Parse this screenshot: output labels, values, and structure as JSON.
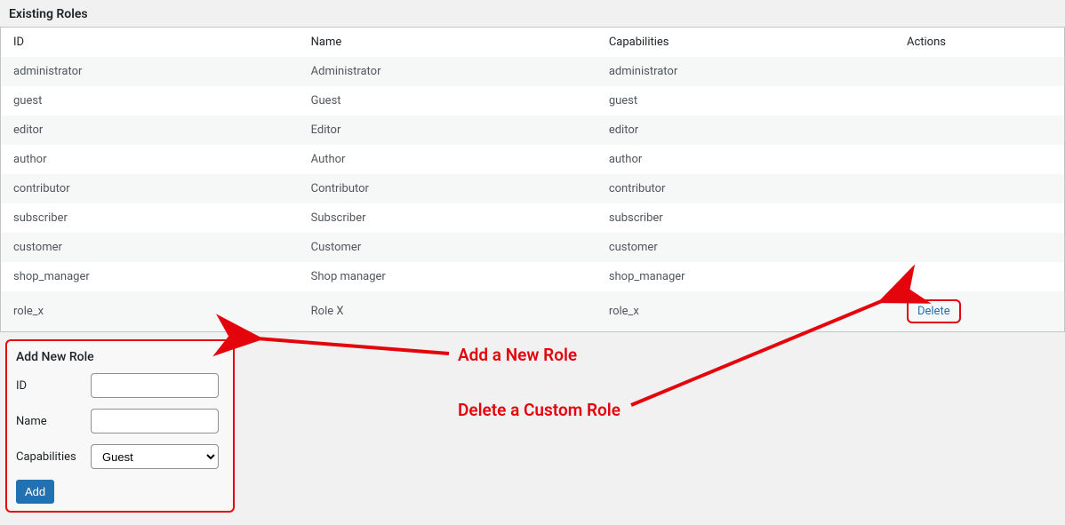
{
  "section_title": "Existing Roles",
  "columns": {
    "id": "ID",
    "name": "Name",
    "capabilities": "Capabilities",
    "actions": "Actions"
  },
  "roles": [
    {
      "id": "administrator",
      "name": "Administrator",
      "capabilities": "administrator",
      "delete": false
    },
    {
      "id": "guest",
      "name": "Guest",
      "capabilities": "guest",
      "delete": false
    },
    {
      "id": "editor",
      "name": "Editor",
      "capabilities": "editor",
      "delete": false
    },
    {
      "id": "author",
      "name": "Author",
      "capabilities": "author",
      "delete": false
    },
    {
      "id": "contributor",
      "name": "Contributor",
      "capabilities": "contributor",
      "delete": false
    },
    {
      "id": "subscriber",
      "name": "Subscriber",
      "capabilities": "subscriber",
      "delete": false
    },
    {
      "id": "customer",
      "name": "Customer",
      "capabilities": "customer",
      "delete": false
    },
    {
      "id": "shop_manager",
      "name": "Shop manager",
      "capabilities": "shop_manager",
      "delete": false
    },
    {
      "id": "role_x",
      "name": "Role X",
      "capabilities": "role_x",
      "delete": true
    }
  ],
  "delete_label": "Delete",
  "add_box": {
    "title": "Add New Role",
    "id_label": "ID",
    "name_label": "Name",
    "caps_label": "Capabilities",
    "id_value": "",
    "name_value": "",
    "caps_selected": "Guest",
    "caps_options": [
      "Guest"
    ],
    "submit_label": "Add"
  },
  "annotations": {
    "add_text": "Add a New Role",
    "delete_text": "Delete a Custom Role"
  },
  "colors": {
    "annotation": "#e3040c",
    "link": "#2271b1",
    "button": "#2271b1"
  }
}
